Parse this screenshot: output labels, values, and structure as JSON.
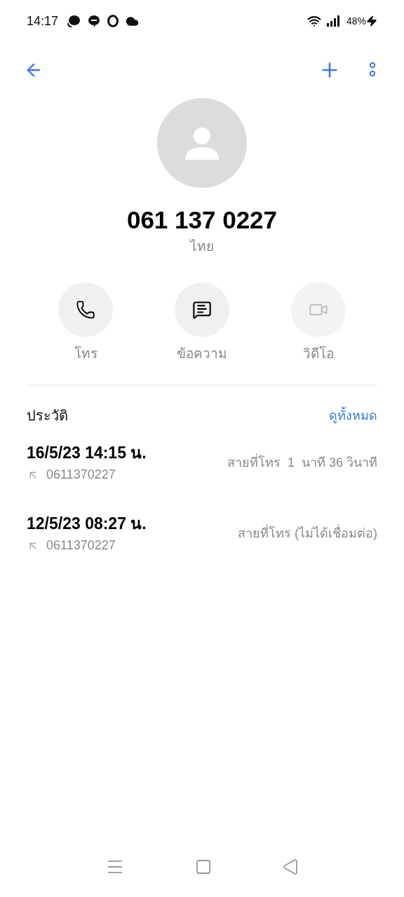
{
  "status_bar": {
    "time": "14:17",
    "battery": "48%"
  },
  "contact": {
    "number": "061 137 0227",
    "location": "ไทย"
  },
  "actions": [
    {
      "kind": "call",
      "label": "โทร",
      "disabled": false
    },
    {
      "kind": "message",
      "label": "ข้อความ",
      "disabled": false
    },
    {
      "kind": "video",
      "label": "วิดีโอ",
      "disabled": true
    }
  ],
  "history": {
    "title": "ประวัติ",
    "link": "ดูทั้งหมด",
    "entries": [
      {
        "datetime": "16/5/23 14:15 น.",
        "number": "0611370227",
        "status": "สายที่โทร  1  นาที 36 วินาที"
      },
      {
        "datetime": "12/5/23 08:27 น.",
        "number": "0611370227",
        "status": "สายที่โทร (ไม่ได้เชื่อมต่อ)"
      }
    ]
  }
}
